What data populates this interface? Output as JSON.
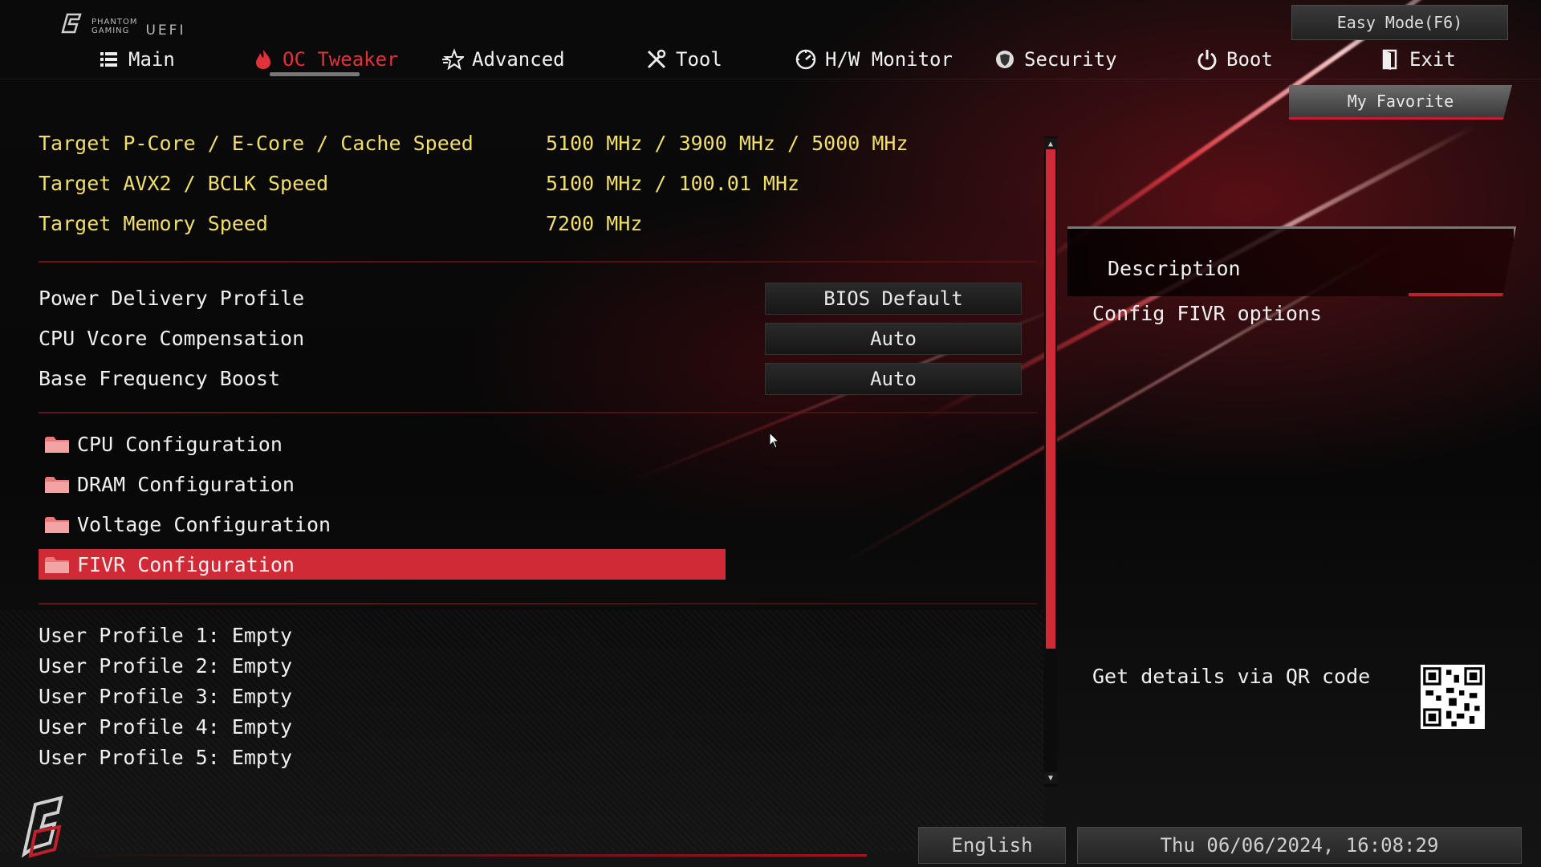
{
  "brand": {
    "line1": "PHANTOM",
    "line2": "GAMING",
    "uefi": "UEFI"
  },
  "header": {
    "easy_mode": "Easy Mode(F6)",
    "my_favorite": "My Favorite"
  },
  "nav": {
    "items": [
      {
        "label": "Main",
        "icon": "list-icon"
      },
      {
        "label": "OC Tweaker",
        "icon": "flame-icon",
        "active": true
      },
      {
        "label": "Advanced",
        "icon": "star-icon"
      },
      {
        "label": "Tool",
        "icon": "tools-icon"
      },
      {
        "label": "H/W Monitor",
        "icon": "gauge-icon"
      },
      {
        "label": "Security",
        "icon": "shield-icon"
      },
      {
        "label": "Boot",
        "icon": "power-icon"
      },
      {
        "label": "Exit",
        "icon": "exit-door-icon"
      }
    ]
  },
  "info": [
    {
      "label": "Target P-Core / E-Core / Cache Speed",
      "value": "5100 MHz / 3900 MHz / 5000 MHz"
    },
    {
      "label": "Target AVX2 / BCLK Speed",
      "value": "5100 MHz / 100.01 MHz"
    },
    {
      "label": "Target Memory Speed",
      "value": "7200 MHz"
    }
  ],
  "settings": [
    {
      "label": "Power Delivery Profile",
      "value": "BIOS Default"
    },
    {
      "label": "CPU Vcore Compensation",
      "value": "Auto"
    },
    {
      "label": "Base Frequency Boost",
      "value": "Auto"
    }
  ],
  "submenus": [
    {
      "label": "CPU Configuration"
    },
    {
      "label": "DRAM Configuration"
    },
    {
      "label": "Voltage Configuration"
    },
    {
      "label": "FIVR Configuration",
      "selected": true
    }
  ],
  "profiles": [
    "User Profile 1: Empty",
    "User Profile 2: Empty",
    "User Profile 3: Empty",
    "User Profile 4: Empty",
    "User Profile 5: Empty"
  ],
  "description": {
    "title": "Description",
    "text": "Config FIVR options",
    "qr_text": "Get details via QR code"
  },
  "footer": {
    "language": "English",
    "datetime": "Thu 06/06/2024, 16:08:29"
  },
  "colors": {
    "accent": "#d12a37",
    "info_text": "#f2df6a"
  }
}
